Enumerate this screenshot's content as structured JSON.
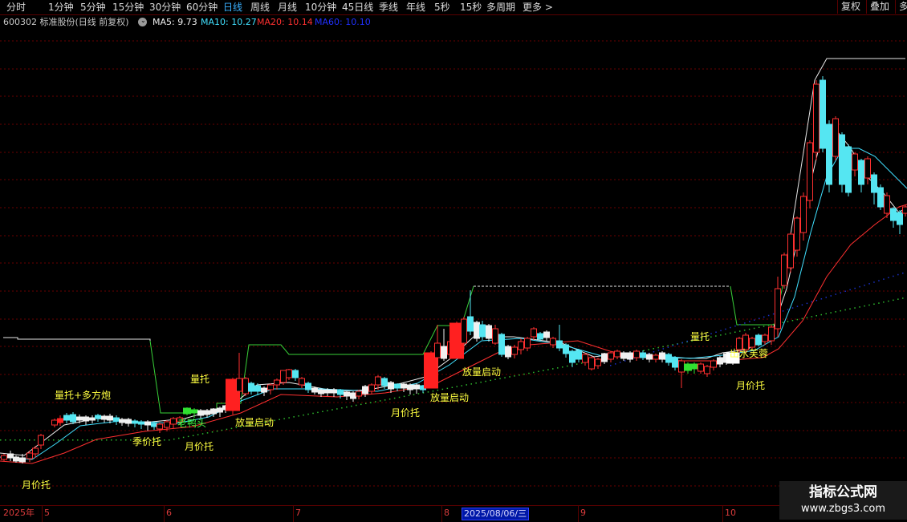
{
  "toolbar": {
    "periods": [
      "分时",
      "1分钟",
      "5分钟",
      "15分钟",
      "30分钟",
      "60分钟",
      "日线",
      "周线",
      "月线",
      "10分钟",
      "45日线",
      "季线",
      "年线",
      "5秒",
      "15秒",
      "多周期",
      "更多 >"
    ],
    "active_index": 6,
    "right_buttons": [
      "复权",
      "叠加",
      "多"
    ]
  },
  "info": {
    "stock": "600302 标准股份(日线 前复权)",
    "ma5": "MA5: 9.73",
    "ma10": "MA10: 10.27",
    "ma20": "MA20: 10.14",
    "ma60": "MA60: 10.10",
    "colors": {
      "ma5": "#f0f0f0",
      "ma10": "#40e0ff",
      "ma20": "#ff3030",
      "ma60": "#2030ff"
    }
  },
  "annotations": [
    {
      "text": "量托+多方炮",
      "color": "#ffff40"
    },
    {
      "text": "月价托",
      "color": "#ffff40"
    },
    {
      "text": "季价托",
      "color": "#ffff40"
    },
    {
      "text": "月价托",
      "color": "#ffff40"
    },
    {
      "text": "老鸭头",
      "color": "#40ff40"
    },
    {
      "text": "量托",
      "color": "#ffff40"
    },
    {
      "text": "放量启动",
      "color": "#ffff40"
    },
    {
      "text": "月价托",
      "color": "#ffff40"
    },
    {
      "text": "放量启动",
      "color": "#ffff40"
    },
    {
      "text": "放量启动",
      "color": "#ffff40"
    },
    {
      "text": "量托",
      "color": "#ffff40"
    },
    {
      "text": "出水芙蓉",
      "color": "#ffff40"
    },
    {
      "text": "月价托",
      "color": "#ffff40"
    }
  ],
  "axis": {
    "year": "2025年",
    "months": [
      "5",
      "6",
      "7",
      "8",
      "9",
      "10"
    ],
    "selected_date": "2025/08/06/三"
  },
  "watermark": {
    "title": "指标公式网",
    "url": "www.zbgs3.com"
  }
}
